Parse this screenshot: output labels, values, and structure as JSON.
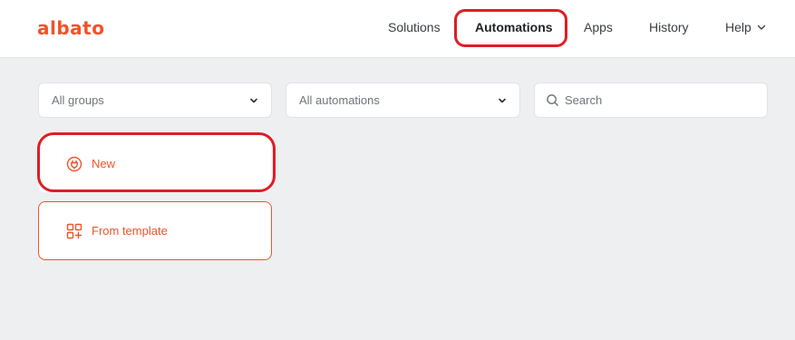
{
  "logo": {
    "text": "albato"
  },
  "nav": {
    "items": [
      {
        "label": "Solutions"
      },
      {
        "label": "Automations"
      },
      {
        "label": "Apps"
      },
      {
        "label": "History"
      },
      {
        "label": "Help"
      }
    ]
  },
  "filters": {
    "groups_value": "All groups",
    "automations_value": "All automations",
    "search_placeholder": "Search"
  },
  "cards": {
    "new_label": "New",
    "template_label": "From template"
  },
  "colors": {
    "accent": "#f0532a",
    "annotation": "#e01d24",
    "background": "#eeeff1"
  }
}
